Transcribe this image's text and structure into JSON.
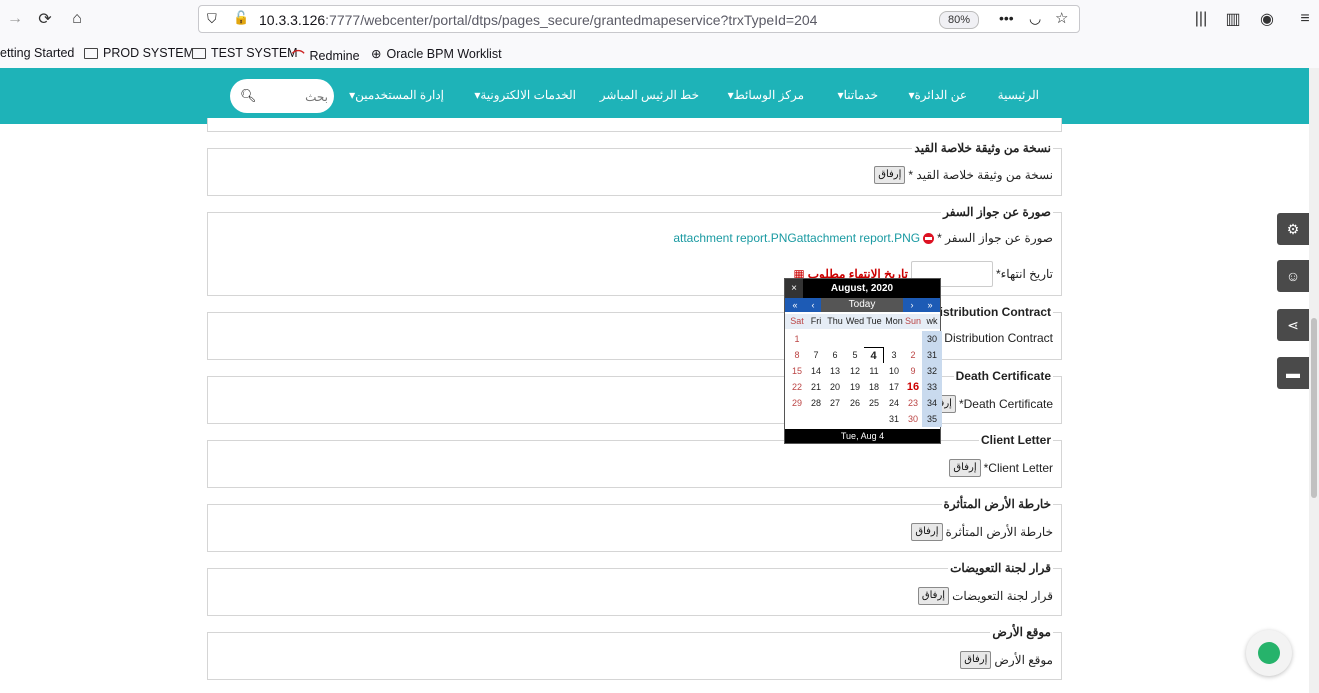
{
  "browser": {
    "url_host": "10.3.3.126",
    "url_rest": ":7777/webcenter/portal/dtps/pages_secure/grantedmapeservice?trxTypeId=204",
    "zoom": "80%",
    "bookmarks": [
      "etting Started",
      "PROD SYSTEM",
      "TEST SYSTEM",
      "Redmine",
      "Oracle BPM Worklist"
    ]
  },
  "nav": {
    "items": [
      "الرئيسية",
      "عن الدائرة▾",
      "خدماتنا▾",
      "مركز الوسائط▾",
      "خط الرئيس المباشر",
      "الخدمات الالكترونية▾",
      "إدارة المستخدمين▾"
    ],
    "search_placeholder": "بحث"
  },
  "form": {
    "attach_label": "إرفاق",
    "sections": [
      {
        "title": "نسخة من وثيقة خلاصة القيد",
        "label": "نسخة من وثيقة خلاصة القيد *"
      },
      {
        "title": "صورة عن جواز السفر",
        "label": "صورة عن جواز السفر *",
        "attachment": "attachment report.PNGattachment report.PNG",
        "expiry_label": "تاريخ انتهاء*",
        "required_msg": "تاريخ الانتهاء مطلوب"
      },
      {
        "title": "Distribution Contract",
        "label": "Distribution Contract"
      },
      {
        "title": "Death Certificate",
        "label": "Death Certificate*"
      },
      {
        "title": "Client Letter",
        "label": "Client Letter*"
      },
      {
        "title": "خارطة الأرض المتأثرة",
        "label": "خارطة الأرض المتأثرة"
      },
      {
        "title": "قرار لجنة التعويضات",
        "label": "قرار لجنة التعويضات"
      },
      {
        "title": "موقع الأرض",
        "label": "موقع الأرض"
      }
    ]
  },
  "calendar": {
    "close": "×",
    "title": "August, 2020",
    "nav": [
      "«",
      "‹",
      "Today",
      "›",
      "»"
    ],
    "days_of_week": [
      "Sat",
      "Fri",
      "Thu",
      "Wed",
      "Tue",
      "Mon",
      "Sun",
      "wk"
    ],
    "weeks": [
      [
        "1",
        "",
        "",
        "",
        "",
        "",
        "",
        "30"
      ],
      [
        "8",
        "7",
        "6",
        "5",
        "4",
        "3",
        "2",
        "31"
      ],
      [
        "15",
        "14",
        "13",
        "12",
        "11",
        "10",
        "9",
        "32"
      ],
      [
        "22",
        "21",
        "20",
        "19",
        "18",
        "17",
        "16",
        "33"
      ],
      [
        "29",
        "28",
        "27",
        "26",
        "25",
        "24",
        "23",
        "34"
      ],
      [
        "",
        "",
        "",
        "",
        "",
        "31",
        "30",
        "35"
      ]
    ],
    "footer": "Tue, Aug 4"
  }
}
